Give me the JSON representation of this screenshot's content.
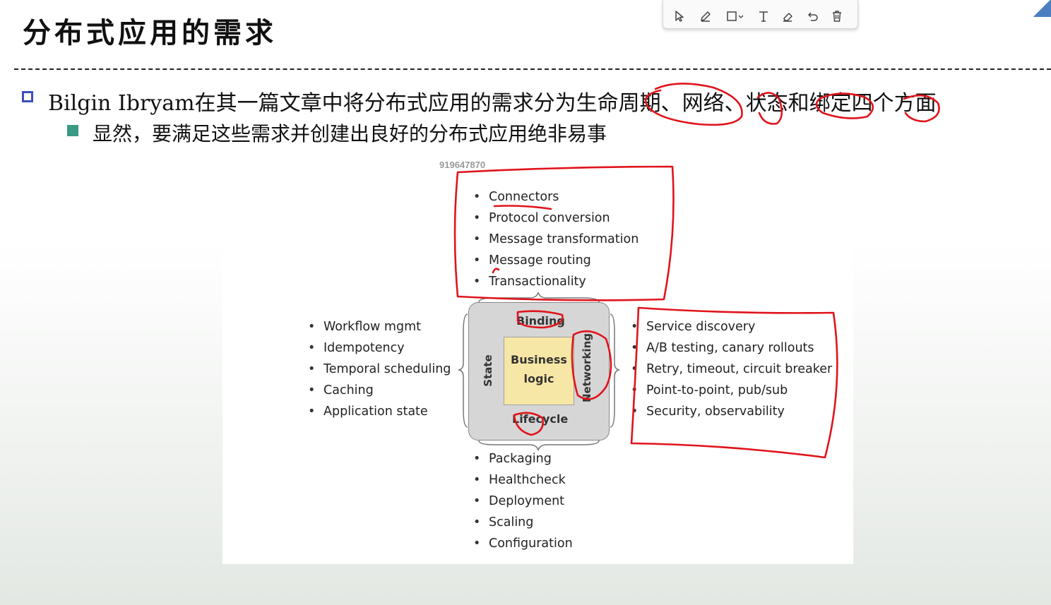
{
  "slide": {
    "title": "分布式应用的需求",
    "bullet1": "Bilgin Ibryam在其一篇文章中将分布式应用的需求分为生命周期、网络、状态和绑定四个方面",
    "bullet2": "显然，要满足这些需求并创建出良好的分布式应用绝非易事"
  },
  "toolbar": {
    "tools": [
      "select-icon",
      "pen-icon",
      "shape-icon",
      "text-icon",
      "eraser-icon",
      "undo-icon",
      "delete-icon"
    ]
  },
  "figure": {
    "id_label": "919647870",
    "binding_items": [
      "Connectors",
      "Protocol conversion",
      "Message transformation",
      "Message routing",
      "Transactionality"
    ],
    "state_items": [
      "Workflow mgmt",
      "Idempotency",
      "Temporal scheduling",
      "Caching",
      "Application state"
    ],
    "networking_items": [
      "Service discovery",
      "A/B testing, canary rollouts",
      "Retry, timeout, circuit breaker",
      "Point-to-point, pub/sub",
      "Security, observability"
    ],
    "lifecycle_items": [
      "Packaging",
      "Healthcheck",
      "Deployment",
      "Scaling",
      "Configuration"
    ],
    "core": {
      "binding": "Binding",
      "lifecycle": "Lifecycle",
      "state": "State",
      "networking": "Networking",
      "business_line1": "Business",
      "business_line2": "logic"
    }
  },
  "colors": {
    "annotation_red": "#e0141b",
    "bullet_blue": "#3b4fb8",
    "bullet_teal": "#3a9a84",
    "core_yellow": "#f7e7a6",
    "core_gray": "#d6d6d6"
  }
}
